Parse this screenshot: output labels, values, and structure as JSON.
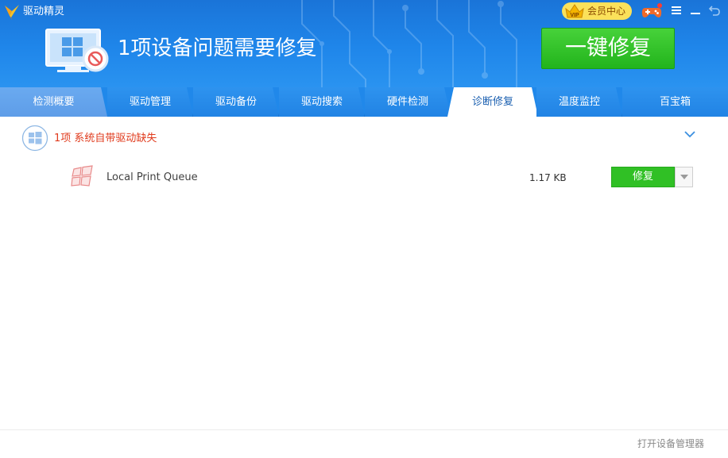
{
  "app": {
    "title": "驱动精灵",
    "logo_icon": "app-logo-icon"
  },
  "header": {
    "vip_label": "会员中心",
    "vip_badge_text": "VIP",
    "headline": "1项设备问题需要修复",
    "fix_all_button": "一键修复",
    "icons": [
      "vip-crown-icon",
      "game-controller-icon",
      "menu-icon",
      "minimize-icon",
      "restore-icon",
      "monitor-repair-icon"
    ]
  },
  "tabs": [
    {
      "label": "检测概要"
    },
    {
      "label": "驱动管理"
    },
    {
      "label": "驱动备份"
    },
    {
      "label": "驱动搜索"
    },
    {
      "label": "硬件检测"
    },
    {
      "label": "诊断修复",
      "active": true
    },
    {
      "label": "温度监控"
    },
    {
      "label": "百宝箱"
    }
  ],
  "issues": {
    "group_title": "1项 系统自带驱动缺失",
    "items": [
      {
        "name": "Local Print Queue",
        "size": "1.17 KB",
        "action": "修复"
      }
    ]
  },
  "footer": {
    "link": "打开设备管理器"
  },
  "colors": {
    "header_blue": "#1f86ea",
    "tab_active_text": "#1a5fb0",
    "green_button": "#30c025",
    "warning_red": "#e03a1c",
    "vip_gold": "#fbe15a"
  }
}
